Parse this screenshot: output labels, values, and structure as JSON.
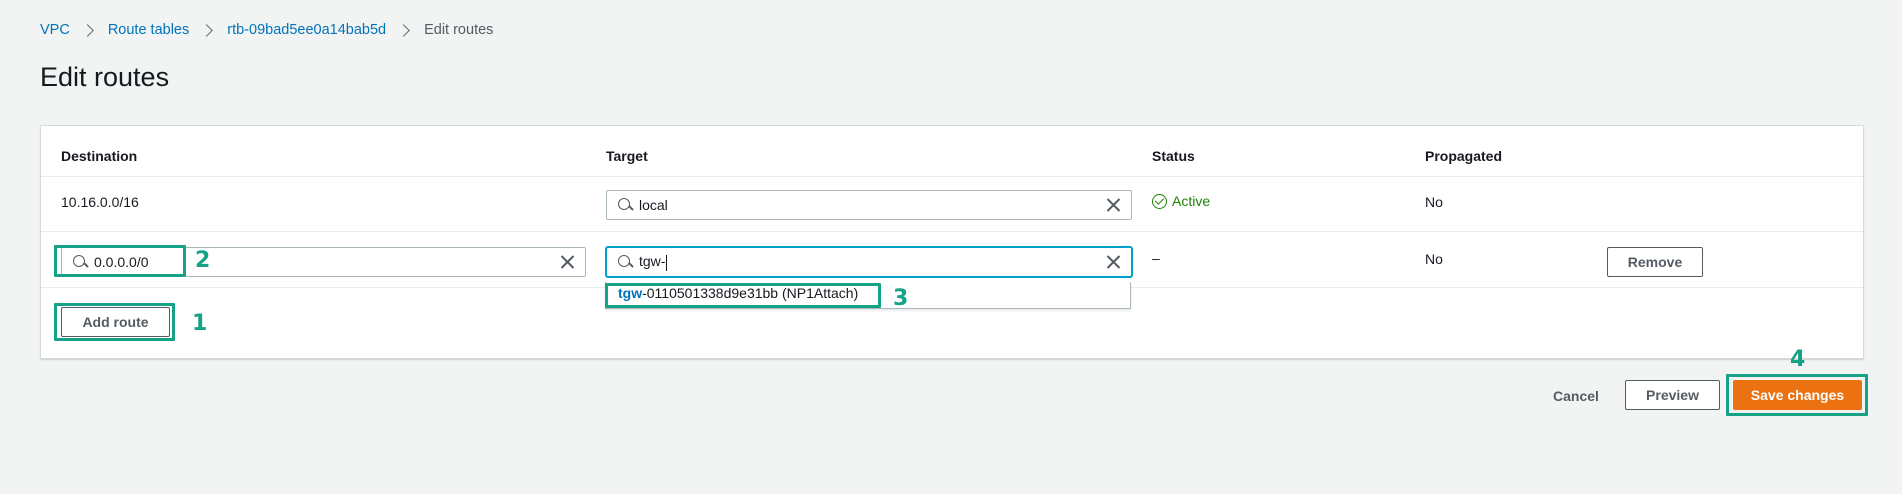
{
  "breadcrumb": {
    "items": [
      "VPC",
      "Route tables",
      "rtb-09bad5ee0a14bab5d"
    ],
    "current": "Edit routes"
  },
  "page": {
    "title": "Edit routes"
  },
  "table": {
    "headers": {
      "destination": "Destination",
      "target": "Target",
      "status": "Status",
      "propagated": "Propagated"
    },
    "rows": [
      {
        "destination": "10.16.0.0/16",
        "target": "local",
        "status": "Active",
        "propagated": "No"
      },
      {
        "destination": "0.0.0.0/0",
        "target": "tgw-",
        "status": "–",
        "propagated": "No",
        "remove_label": "Remove"
      }
    ]
  },
  "dropdown": {
    "option_match": "tgw",
    "option_rest": "-0110501338d9e31bb (NP1Attach)"
  },
  "buttons": {
    "add_route": "Add route",
    "cancel": "Cancel",
    "preview": "Preview",
    "save": "Save changes"
  },
  "annotations": {
    "n1": "1",
    "n2": "2",
    "n3": "3",
    "n4": "4"
  },
  "colors": {
    "link": "#0073bb",
    "primary": "#ec7211",
    "success": "#1d8102",
    "annotation": "#16a286",
    "focus": "#00a1c9"
  },
  "icons": [
    "chevron-right-icon",
    "search-icon",
    "clear-icon",
    "check-circle-icon"
  ]
}
